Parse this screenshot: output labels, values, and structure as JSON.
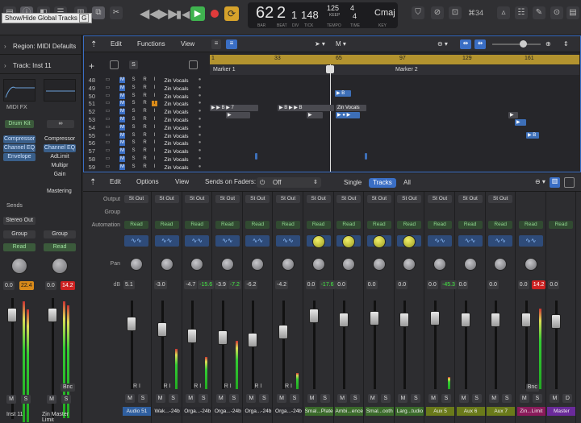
{
  "toolbar": {
    "tooltip": "Show/Hide Global Tracks",
    "tooltip_key": "G",
    "lcd": {
      "bar": "62",
      "beat": "2",
      "div": "1",
      "tick": "148",
      "bar_lbl": "BAR",
      "beat_lbl": "BEAT",
      "div_lbl": "DIV",
      "tick_lbl": "TICK",
      "tempo": "125",
      "tempo_sub": "KEEP",
      "tempo_lbl": "TEMPO",
      "sig_top": "4",
      "sig_bot": "4",
      "time_lbl": "TIME",
      "key": "Cmaj",
      "key_lbl": "KEY"
    },
    "counter": "⌘34"
  },
  "inspector": {
    "region": "Region: MIDI Defaults",
    "track": "Track: Inst 11",
    "midi_fx": "MIDI FX",
    "s1": {
      "plugin": "Drum Kit",
      "inserts": [
        "Compressor",
        "Channel EQ",
        "Envelope"
      ],
      "sends": "Sends",
      "output": "Stereo Out",
      "group": "Group",
      "auto": "Read",
      "vol": "0.0",
      "peak": "22.4",
      "name": "Inst 11",
      "m": "M",
      "s": "S"
    },
    "s2": {
      "link": "∞",
      "inserts": [
        "Compressor",
        "Channel EQ",
        "AdLimit",
        "Multipr",
        "Gain"
      ],
      "mastering": "Mastering",
      "group": "Group",
      "auto": "Read",
      "vol": "0.0",
      "peak": "14.2",
      "bnc": "Bnc",
      "name": "Zin Master Limit",
      "m": "M",
      "s": "S"
    }
  },
  "tracks": {
    "menus": [
      "Edit",
      "Functions",
      "View"
    ],
    "ruler": [
      "1",
      "33",
      "65",
      "97",
      "129",
      "161"
    ],
    "markers": [
      "Marker 1",
      "Marker 2"
    ],
    "rows": [
      {
        "n": "48",
        "name": "Zin Vocals"
      },
      {
        "n": "49",
        "name": "Zin Vocals"
      },
      {
        "n": "50",
        "name": "Zin Vocals"
      },
      {
        "n": "51",
        "name": "Zin Vocals"
      },
      {
        "n": "52",
        "name": "Zin Vocals"
      },
      {
        "n": "53",
        "name": "Zin Vocals"
      },
      {
        "n": "54",
        "name": "Zin Vocals"
      },
      {
        "n": "55",
        "name": "Zin Vocals"
      },
      {
        "n": "56",
        "name": "Zin Vocals"
      },
      {
        "n": "57",
        "name": "Zin Vocals"
      },
      {
        "n": "58",
        "name": "Zin Vocals"
      },
      {
        "n": "59",
        "name": "Zin Vocals"
      }
    ],
    "msri": [
      "M",
      "S",
      "R",
      "I"
    ],
    "region_label": "Zin Vocals"
  },
  "mixer": {
    "menus": [
      "Edit",
      "Options",
      "View"
    ],
    "sends_label": "Sends on Faders:",
    "sends_value": "Off",
    "views": [
      "Single",
      "Tracks",
      "All"
    ],
    "row_labels": [
      "Output",
      "Group",
      "Automation",
      "Pan",
      "dB"
    ],
    "strips": [
      {
        "out": "St Out",
        "auto": "Read",
        "vol": "5.1",
        "peak": "",
        "name": "Audio 51",
        "knob": "gray",
        "color": "#2f5fa0",
        "ri": "R I"
      },
      {
        "out": "St Out",
        "auto": "Read",
        "vol": "-3.0",
        "peak": "",
        "name": "Wak...-24b",
        "knob": "gray",
        "color": "#2a2a2e",
        "ri": "R I"
      },
      {
        "out": "St Out",
        "auto": "Read",
        "vol": "-4.7",
        "peak": "-15.6",
        "name": "Orga...-24b",
        "knob": "gray",
        "color": "#2a2a2e",
        "ri": "R I"
      },
      {
        "out": "St Out",
        "auto": "Read",
        "vol": "-3.9",
        "peak": "-7.2",
        "name": "Orga...-24b",
        "knob": "gray",
        "color": "#2a2a2e",
        "ri": "R I"
      },
      {
        "out": "St Out",
        "auto": "Read",
        "vol": "-6.2",
        "peak": "",
        "name": "Orga...-24b",
        "knob": "gray",
        "color": "#2a2a2e",
        "ri": "R I"
      },
      {
        "out": "St Out",
        "auto": "Read",
        "vol": "-4.2",
        "peak": "",
        "name": "Orga...-24b",
        "knob": "gray",
        "color": "#2a2a2e",
        "ri": "R I"
      },
      {
        "out": "St Out",
        "auto": "Read",
        "vol": "0.0",
        "peak": "-17.6",
        "name": "Smal...Plate",
        "knob": "yellow",
        "color": "#3a6a2a",
        "ri": ""
      },
      {
        "out": "St Out",
        "auto": "Read",
        "vol": "0.0",
        "peak": "",
        "name": "Ambi...ence",
        "knob": "yellow",
        "color": "#3a6a2a",
        "ri": ""
      },
      {
        "out": "St Out",
        "auto": "Read",
        "vol": "0.0",
        "peak": "",
        "name": "Smal...ooth",
        "knob": "yellow",
        "color": "#3a6a2a",
        "ri": ""
      },
      {
        "out": "St Out",
        "auto": "Read",
        "vol": "0.0",
        "peak": "",
        "name": "Larg...tudio",
        "knob": "yellow",
        "color": "#3a6a2a",
        "ri": ""
      },
      {
        "out": "St Out",
        "auto": "Read",
        "vol": "0.0",
        "peak": "-45.3",
        "name": "Aux 5",
        "knob": "gray",
        "color": "#6a7a1a",
        "ri": ""
      },
      {
        "out": "St Out",
        "auto": "Read",
        "vol": "0.0",
        "peak": "",
        "name": "Aux 6",
        "knob": "gray",
        "color": "#6a7a1a",
        "ri": ""
      },
      {
        "out": "St Out",
        "auto": "Read",
        "vol": "0.0",
        "peak": "",
        "name": "Aux 7",
        "knob": "gray",
        "color": "#6a7a1a",
        "ri": ""
      },
      {
        "out": "",
        "auto": "Read",
        "vol": "0.0",
        "peak": "14.2",
        "name": "Zin...Limit",
        "knob": "gray",
        "color": "#8a1a5a",
        "ri": ""
      },
      {
        "out": "",
        "auto": "Read",
        "vol": "0.0",
        "peak": "",
        "name": "Master",
        "knob": "none",
        "color": "#6a2a9a",
        "ri": ""
      }
    ],
    "bnc": "Bnc",
    "m": "M",
    "s": "S",
    "d": "D"
  }
}
